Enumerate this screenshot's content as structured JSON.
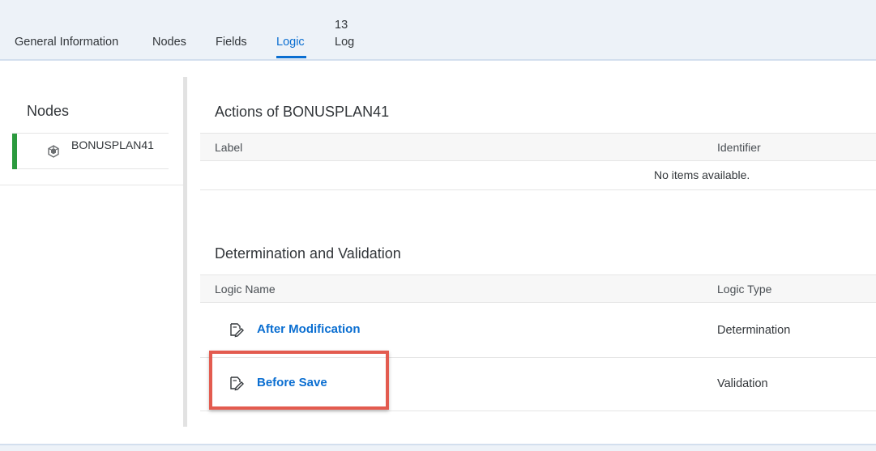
{
  "tabs": [
    {
      "label": "General Information"
    },
    {
      "label": "Nodes"
    },
    {
      "label": "Fields"
    },
    {
      "label": "Logic",
      "active": true
    },
    {
      "label": "Log",
      "count": "13"
    }
  ],
  "sidebar": {
    "title": "Nodes",
    "items": [
      {
        "label": "BONUSPLAN41",
        "icon": "cube-icon",
        "status_color": "#2b9a3e"
      }
    ]
  },
  "actions": {
    "title": "Actions of BONUSPLAN41",
    "columns": [
      "Label",
      "Identifier"
    ],
    "empty_text": "No items available."
  },
  "logic": {
    "title": "Determination and Validation",
    "columns": [
      "Logic Name",
      "Logic Type"
    ],
    "rows": [
      {
        "name": "After Modification",
        "type": "Determination",
        "icon": "edit-document-icon"
      },
      {
        "name": "Before Save",
        "type": "Validation",
        "icon": "edit-document-icon"
      }
    ]
  },
  "colors": {
    "accent": "#0a6ed1",
    "highlight": "#e35b4f",
    "node_marker": "#2b9a3e"
  }
}
